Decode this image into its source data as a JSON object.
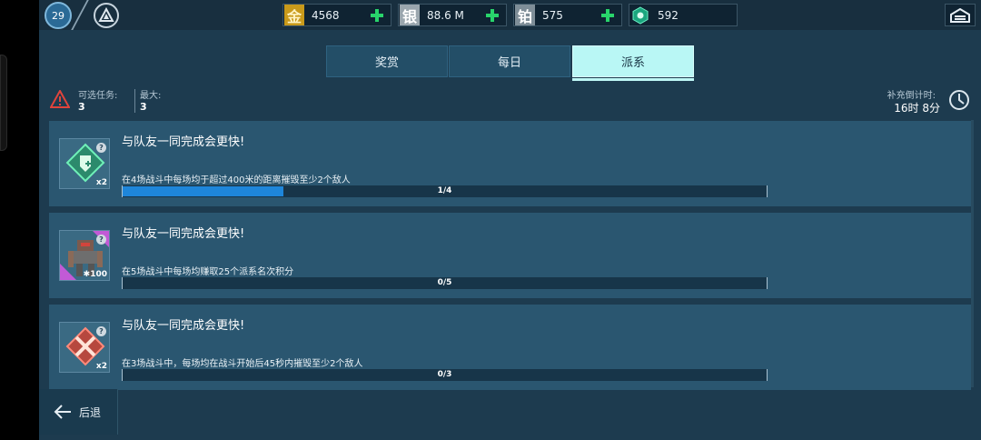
{
  "topbar": {
    "level": "29",
    "currencies": [
      {
        "icon_label": "金",
        "value": "4568",
        "icon_bg": "#c99a1a",
        "icon_color": "#fff3c4"
      },
      {
        "icon_label": "银",
        "value": "88.6 M",
        "icon_bg": "#9aa6ae",
        "icon_color": "#ffffff"
      },
      {
        "icon_label": "铂",
        "value": "575",
        "icon_bg": "#7f8e98",
        "icon_color": "#ffffff"
      },
      {
        "icon_label": "",
        "value": "592",
        "icon_bg": "#1aa67e",
        "icon_color": "#ffffff"
      }
    ],
    "plus_color": "#28d46b"
  },
  "tabs": [
    {
      "label": "奖赏",
      "active": false
    },
    {
      "label": "每日",
      "active": false
    },
    {
      "label": "派系",
      "active": true
    }
  ],
  "info": {
    "available_label": "可选任务:",
    "available_value": "3",
    "max_label": "最大:",
    "max_value": "3",
    "refill_label": "补充倒计时:",
    "refill_value": "16时 8分"
  },
  "quests": [
    {
      "title": "与队友一同完成会更快!",
      "description": "在4场战斗中每场均于超过400米的距离摧毁至少2个敌人",
      "progress_text": "1/4",
      "progress": 0.25,
      "reward_count": "x2",
      "icon": "shield-module-icon"
    },
    {
      "title": "与队友一同完成会更快!",
      "description": "在5场战斗中每场均赚取25个派系名次积分",
      "progress_text": "0/5",
      "progress": 0,
      "reward_count": "100",
      "icon": "robot-icon"
    },
    {
      "title": "与队友一同完成会更快!",
      "description": "在3场战斗中，每场均在战斗开始后45秒内摧毁至少2个敌人",
      "progress_text": "0/3",
      "progress": 0,
      "reward_count": "x2",
      "icon": "crossed-swords-icon"
    }
  ],
  "back_label": "后退",
  "colors": {
    "background": "#1d3b4f",
    "card": "#2a5670",
    "active_tab": "#b9f7f5",
    "progress_fill": "#1e86da"
  }
}
